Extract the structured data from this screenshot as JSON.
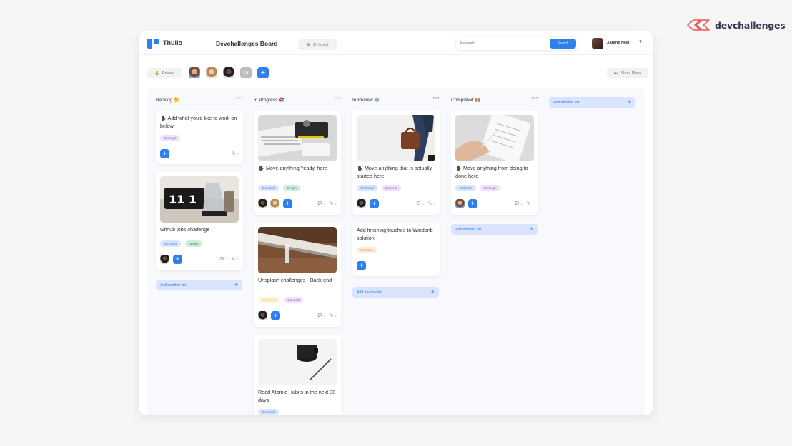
{
  "brand": {
    "name": "devchallenges"
  },
  "topbar": {
    "app_name": "Thullo",
    "board_title": "Devchallenges Board",
    "all_board_label": "All board",
    "search_placeholder": "Keyword...",
    "search_button": "Search",
    "user_name": "Xanthe Neal"
  },
  "subbar": {
    "visibility": "Private",
    "member_initials": "TN",
    "show_menu": "Show Menu"
  },
  "columns": [
    {
      "title": "Backlog 🤔",
      "add_label": "Add another list",
      "cards": [
        {
          "title": "✋🏿 Add what you'd like to work on below",
          "tags": [
            "Concept"
          ],
          "attachments": "1"
        },
        {
          "title": "Github jobs challenge",
          "tags": [
            "Technical",
            "Design"
          ],
          "comments": "2",
          "attachments": "1"
        }
      ]
    },
    {
      "title": "In Progress 📚",
      "cards": [
        {
          "title": "✋🏿 Move anything 'ready' here",
          "tags": [
            "Technical",
            "Design"
          ],
          "comments": "2",
          "attachments": "1"
        },
        {
          "title": "Unsplash challenges - Back-end",
          "tags": [
            "Document",
            "Concept"
          ],
          "comments": "2",
          "attachments": "1"
        },
        {
          "title": "Read Atomic Habits in the next 30 days",
          "tags": [
            "Technical"
          ]
        }
      ]
    },
    {
      "title": "In Review ⚙️",
      "add_label": "Add another list",
      "cards": [
        {
          "title": "✋🏿 Move anything that is actually started here",
          "tags": [
            "Technical",
            "Concept"
          ],
          "comments": "2",
          "attachments": "1"
        },
        {
          "title": "Add finishing touches to Windbnb solution",
          "tags": [
            "Fullstack"
          ]
        }
      ]
    },
    {
      "title": "Completed 🙌🏽",
      "add_label": "Add another list",
      "cards": [
        {
          "title": "✋🏿 Move anything from doing to done here",
          "tags": [
            "Technical",
            "Concept"
          ],
          "comments": "1",
          "attachments": "1"
        }
      ]
    }
  ],
  "extra_add_label": "Add another list",
  "colors": {
    "accent": "#2f80ed",
    "board_bg": "#f8f9fd"
  }
}
